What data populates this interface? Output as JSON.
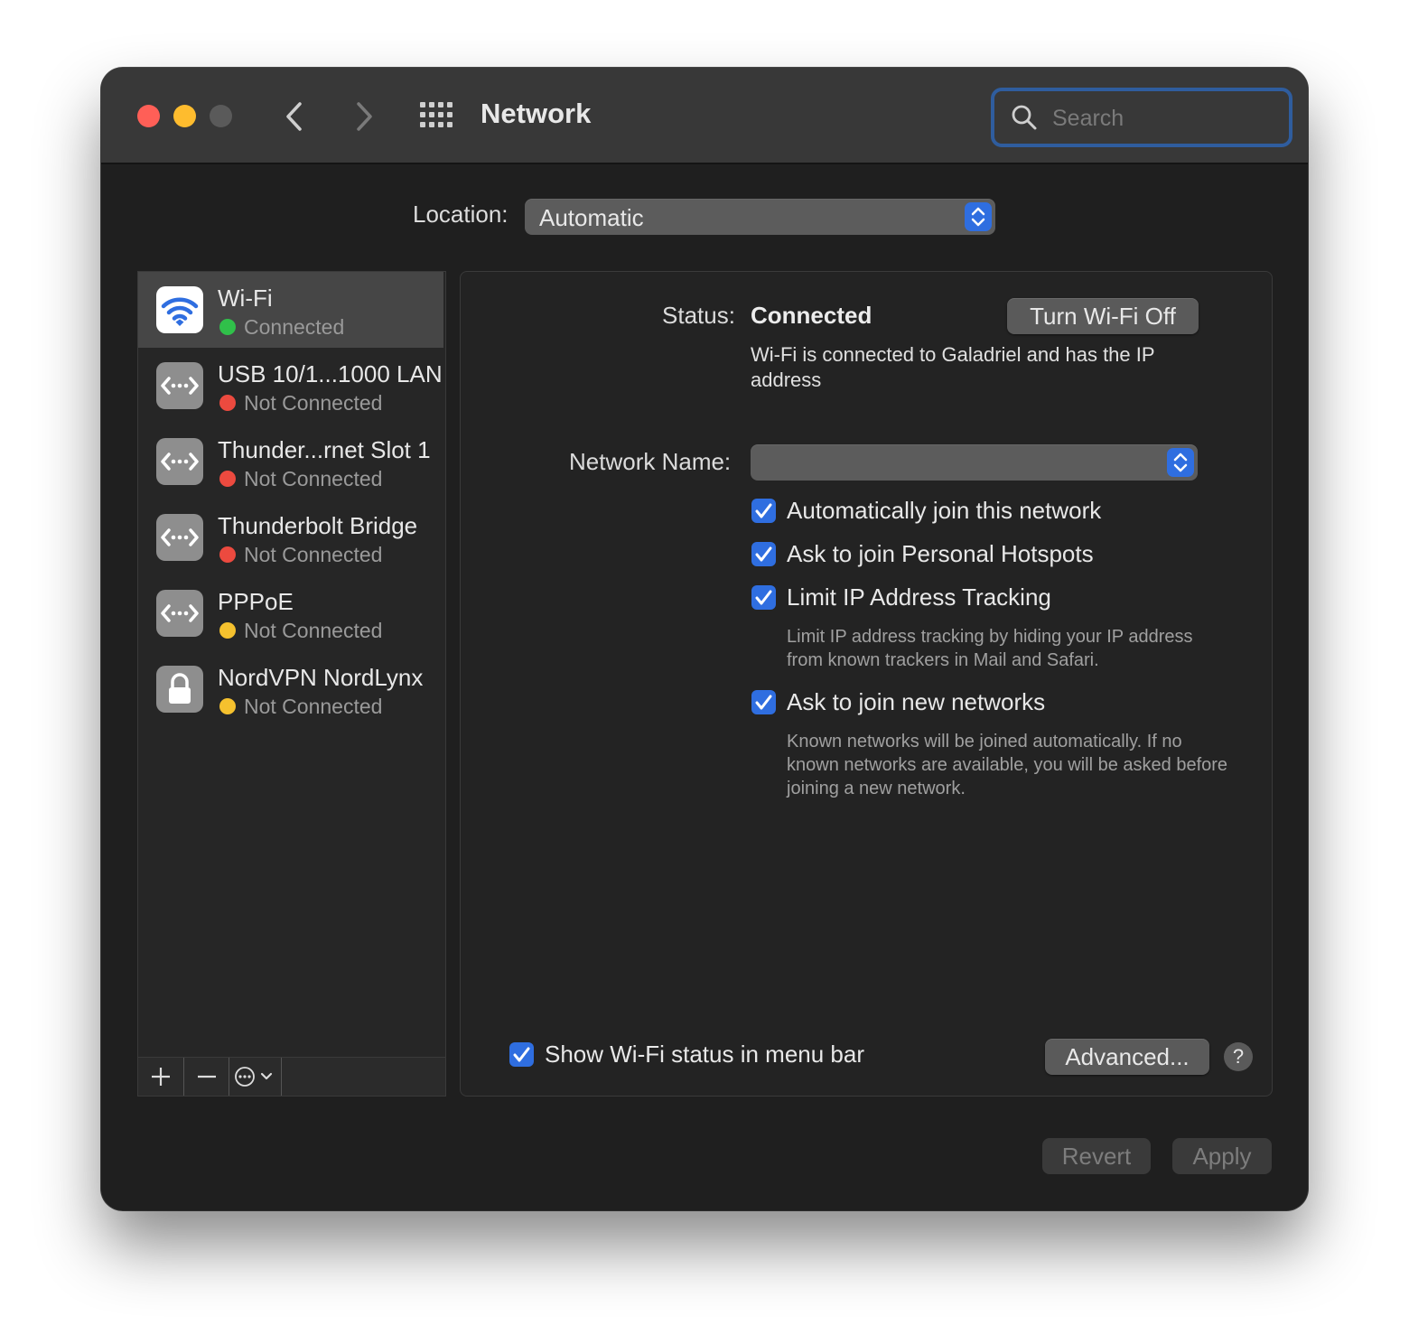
{
  "window": {
    "title": "Network",
    "search_placeholder": "Search"
  },
  "location": {
    "label": "Location:",
    "value": "Automatic"
  },
  "services": [
    {
      "name": "Wi-Fi",
      "status": "Connected",
      "status_color": "#30c04a",
      "icon": "wifi-icon",
      "selected": true
    },
    {
      "name": "USB 10/1...1000 LAN",
      "status": "Not Connected",
      "status_color": "#ec4a3f",
      "icon": "ethernet-icon"
    },
    {
      "name": "Thunder...rnet Slot 1",
      "status": "Not Connected",
      "status_color": "#ec4a3f",
      "icon": "ethernet-icon"
    },
    {
      "name": "Thunderbolt Bridge",
      "status": "Not Connected",
      "status_color": "#ec4a3f",
      "icon": "ethernet-icon"
    },
    {
      "name": "PPPoE",
      "status": "Not Connected",
      "status_color": "#f5c12e",
      "icon": "ethernet-icon"
    },
    {
      "name": "NordVPN NordLynx",
      "status": "Not Connected",
      "status_color": "#f5c12e",
      "icon": "lock-icon"
    }
  ],
  "detail": {
    "status_label": "Status:",
    "status_value": "Connected",
    "toggle_button": "Turn Wi-Fi Off",
    "status_description": "Wi-Fi is connected to Galadriel and has the IP address",
    "network_name_label": "Network Name:",
    "network_name_value": "",
    "options": [
      {
        "label": "Automatically join this network",
        "checked": true,
        "help": ""
      },
      {
        "label": "Ask to join Personal Hotspots",
        "checked": true,
        "help": ""
      },
      {
        "label": "Limit IP Address Tracking",
        "checked": true,
        "help": "Limit IP address tracking by hiding your IP address from known trackers in Mail and Safari."
      },
      {
        "label": "Ask to join new networks",
        "checked": true,
        "help": "Known networks will be joined automatically. If no known networks are available, you will be asked before joining a new network."
      }
    ],
    "show_status_label": "Show Wi-Fi status in menu bar",
    "advanced_button": "Advanced...",
    "help_button": "?"
  },
  "footer": {
    "revert_button": "Revert",
    "apply_button": "Apply"
  },
  "colors": {
    "accent": "#2f6ee0",
    "window_bg": "#1f1f1f",
    "titlebar_bg": "#383838"
  }
}
